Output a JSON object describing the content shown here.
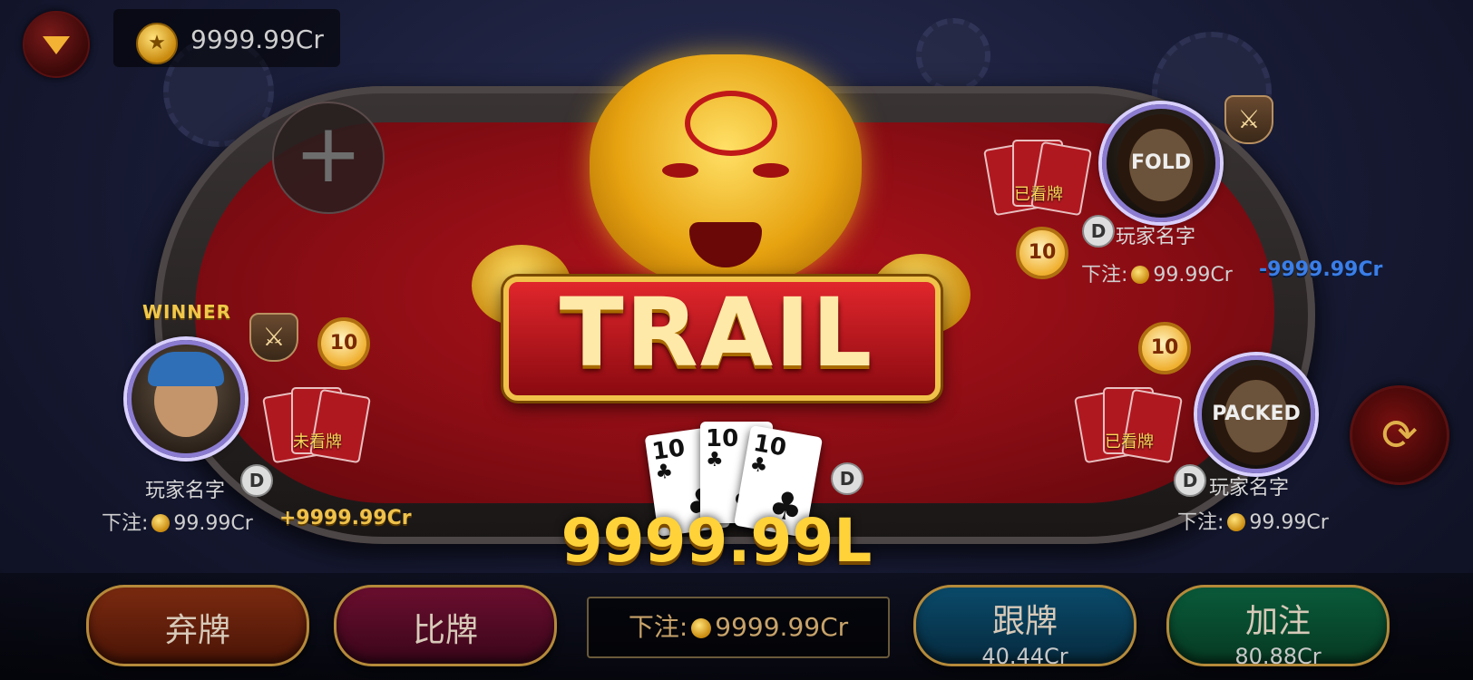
{
  "top": {
    "balance": "9999.99Cr"
  },
  "players": [
    {
      "id": "left",
      "name": "玩家名字",
      "bet_label": "下注:",
      "bet_value": "99.99Cr",
      "winner_tag": "WINNER",
      "cards_label": "未看牌",
      "timer": "10",
      "change": "+9999.99Cr",
      "dealer": "D"
    },
    {
      "id": "right-top",
      "name": "玩家名字",
      "bet_label": "下注:",
      "bet_value": "99.99Cr",
      "status": "FOLD",
      "cards_label": "已看牌",
      "timer": "10",
      "change": "-9999.99Cr",
      "dealer": "D"
    },
    {
      "id": "right-bottom",
      "name": "玩家名字",
      "bet_label": "下注:",
      "bet_value": "99.99Cr",
      "status": "PACKED",
      "cards_label": "已看牌",
      "timer": "10",
      "dealer": "D"
    }
  ],
  "center": {
    "hand_name": "TRAIL",
    "pot": "9999.99L",
    "cards": [
      {
        "rank": "10",
        "suit": "♣"
      },
      {
        "rank": "10",
        "suit": "♣"
      },
      {
        "rank": "10",
        "suit": "♣"
      }
    ],
    "dealer": "D"
  },
  "actions": {
    "fold": {
      "label": "弃牌"
    },
    "compare": {
      "label": "比牌"
    },
    "call": {
      "label": "跟牌",
      "amount": "40.44Cr"
    },
    "raise": {
      "label": "加注",
      "amount": "80.88Cr"
    },
    "bet": {
      "label": "下注:",
      "value": "9999.99Cr"
    }
  },
  "icons": {
    "menu": "triangle-down-icon",
    "add": "plus-icon",
    "switch_table": "table-swap-icon",
    "coin": "coin-icon",
    "alarm": "alarm-clock-icon",
    "swords": "crossed-swords-icon"
  }
}
